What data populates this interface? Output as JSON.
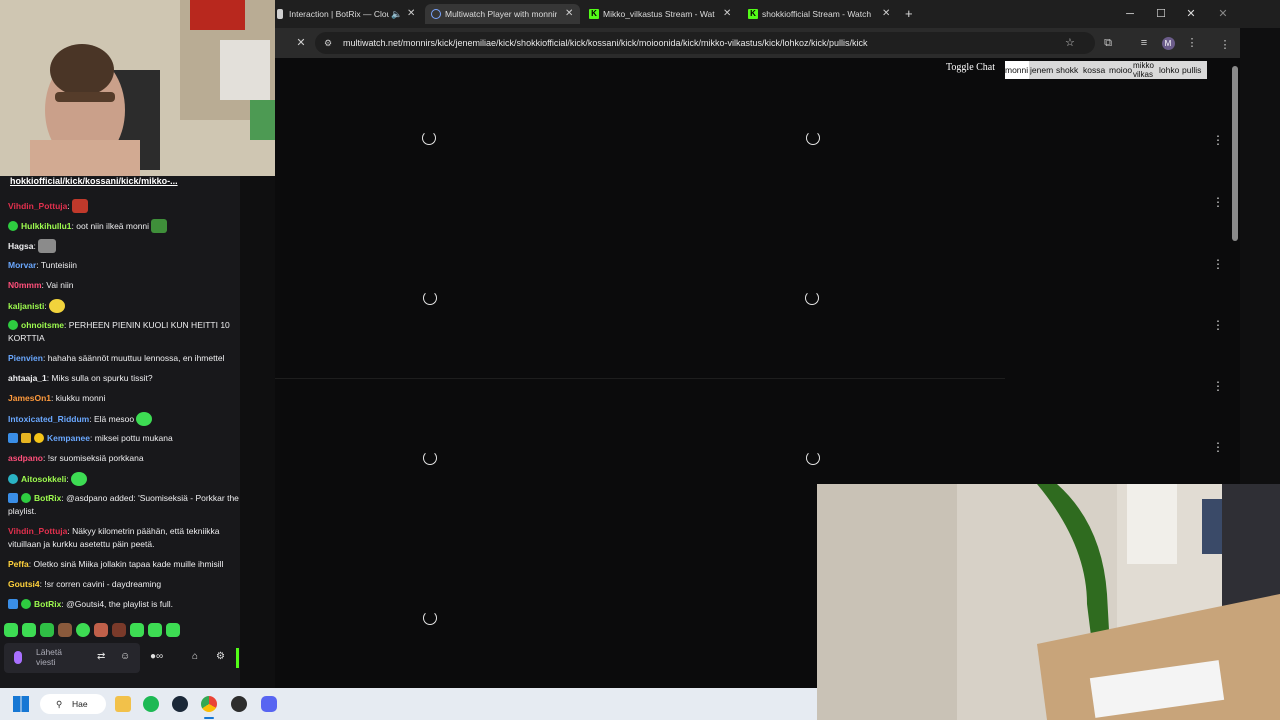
{
  "browser": {
    "tabs": [
      {
        "label": "Interaction | BotRix — Clou",
        "active": false
      },
      {
        "label": "Multiwatch Player with monnirs",
        "active": true
      },
      {
        "label": "Mikko_vilkastus Stream - Watch",
        "active": false
      },
      {
        "label": "shokkiofficial Stream - Watch Li",
        "active": false
      }
    ],
    "new_tab": "+",
    "url": "multiwatch.net/monnirs/kick/jenemiliae/kick/shokkiofficial/kick/kossani/kick/moioonida/kick/mikko-vilkastus/kick/lohkoz/kick/pullis/kick",
    "profile_initial": "M"
  },
  "multiwatch": {
    "toggle_chat": "Toggle Chat",
    "channel_tabs": [
      "monni",
      "jenem",
      "shokk",
      "kossa",
      "moioo",
      "mikko vilkas",
      "lohko",
      "pullis"
    ]
  },
  "chat": {
    "pinned_text": "hokkiofficial/kick/kossani/kick/mikko-...",
    "messages": [
      {
        "user": "Vihdin_Pottuja",
        "color": "#e0304d",
        "text": ""
      },
      {
        "user": "Hulkkihullu1",
        "color": "#9efc4f",
        "text": "oot niin ilkeä monni"
      },
      {
        "user": "Hagsa",
        "color": "#efeff1",
        "text": ""
      },
      {
        "user": "Morvar",
        "color": "#6aa8ff",
        "text": "Tunteisiin"
      },
      {
        "user": "N0mmm",
        "color": "#ff4f7a",
        "text": "Vai niin"
      },
      {
        "user": "kaljanisti",
        "color": "#9efc4f",
        "text": ""
      },
      {
        "user": "ohnoitsme",
        "color": "#9efc4f",
        "text": "PERHEEN PIENIN KUOLI KUN HEITTI 10 KORTTIA"
      },
      {
        "user": "Pienvien",
        "color": "#6aa8ff",
        "text": "hahaha säännöt muuttuu lennossa, en ihmettel"
      },
      {
        "user": "ahtaaja_1",
        "color": "#efeff1",
        "text": "Miks sulla on spurku tissit?"
      },
      {
        "user": "JamesOn1",
        "color": "#ff9a3c",
        "text": "kiukku monni"
      },
      {
        "user": "Intoxicated_Riddum",
        "color": "#6aa8ff",
        "text": "Elä mesoo"
      },
      {
        "user": "Kempanee",
        "color": "#6aa8ff",
        "text": "miksei pottu mukana"
      },
      {
        "user": "asdpano",
        "color": "#ff4f7a",
        "text": "!sr suomiseksiä porkkana"
      },
      {
        "user": "Aitosokkeli",
        "color": "#9efc4f",
        "text": ""
      },
      {
        "user": "BotRix",
        "color": "#9efc4f",
        "text": "@asdpano added: 'Suomiseksiä - Porkkar the playlist."
      },
      {
        "user": "Vihdin_Pottuja",
        "color": "#e0304d",
        "text": "Näkyy kilometrin päähän, että tekniikka vituillaan ja kurkku asetettu päin peetä."
      },
      {
        "user": "Peffa",
        "color": "#ffd23c",
        "text": "Oletko sinä Miika jollakin tapaa kade muille ihmisill"
      },
      {
        "user": "Goutsi4",
        "color": "#ffd23c",
        "text": "!sr corren cavini - daydreaming"
      },
      {
        "user": "BotRix",
        "color": "#9efc4f",
        "text": "@Goutsi4, the playlist is full."
      }
    ],
    "composer_placeholder": "Lähetä viesti"
  },
  "taskbar": {
    "search_label": "Hae"
  },
  "colors": {
    "kick_green": "#53fc18",
    "chat_bg": "#18181b",
    "page_bg": "#0b0b0c"
  }
}
